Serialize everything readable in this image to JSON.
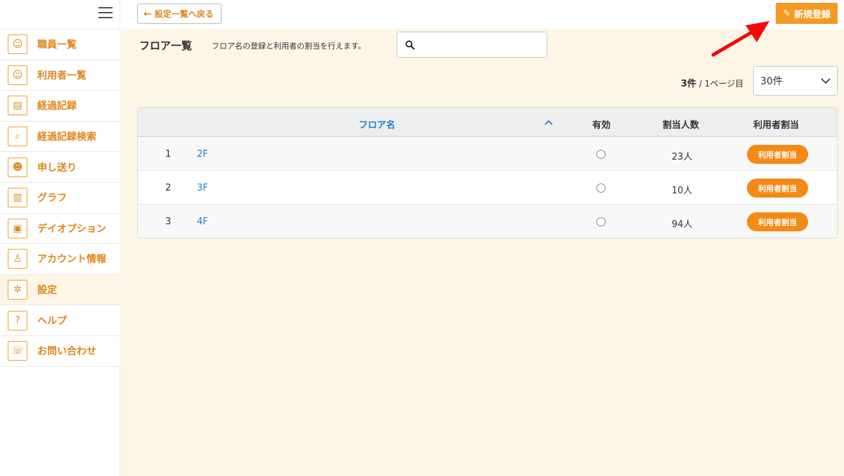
{
  "sidebar": {
    "items": [
      {
        "label": "職員一覧",
        "icon": "staff-icon",
        "glyph": "☺"
      },
      {
        "label": "利用者一覧",
        "icon": "user-icon",
        "glyph": "☺"
      },
      {
        "label": "経過記録",
        "icon": "clipboard-icon",
        "glyph": "▤"
      },
      {
        "label": "経過記録検索",
        "icon": "search-record-icon",
        "glyph": "⌕"
      },
      {
        "label": "申し送り",
        "icon": "handover-icon",
        "glyph": "☻"
      },
      {
        "label": "グラフ",
        "icon": "chart-icon",
        "glyph": "▥"
      },
      {
        "label": "デイオプション",
        "icon": "bus-icon",
        "glyph": "▣"
      },
      {
        "label": "アカウント情報",
        "icon": "account-icon",
        "glyph": "♙"
      },
      {
        "label": "設定",
        "icon": "gear-icon",
        "glyph": "✲"
      },
      {
        "label": "ヘルプ",
        "icon": "help-icon",
        "glyph": "?"
      },
      {
        "label": "お問い合わせ",
        "icon": "contact-icon",
        "glyph": "☏"
      }
    ]
  },
  "topbar": {
    "back_label": "設定一覧へ戻る",
    "new_label": "新規登録"
  },
  "header": {
    "title": "フロア一覧",
    "description": "フロア名の登録と利用者の割当を行えます。",
    "search_placeholder": ""
  },
  "pagination": {
    "count": "3件",
    "page_info": "/ 1ページ目",
    "per_page": "30件"
  },
  "table": {
    "columns": {
      "name": "フロア名",
      "valid": "有効",
      "count": "割当人数",
      "assign": "利用者割当"
    },
    "rows": [
      {
        "no": "1",
        "name": "2F",
        "count": "23人",
        "button": "利用者割当"
      },
      {
        "no": "2",
        "name": "3F",
        "count": "10人",
        "button": "利用者割当"
      },
      {
        "no": "3",
        "name": "4F",
        "count": "94人",
        "button": "利用者割当"
      }
    ]
  },
  "colors": {
    "accent": "#f39a22",
    "link": "#1a7fd4",
    "background": "#fdf5e6"
  }
}
